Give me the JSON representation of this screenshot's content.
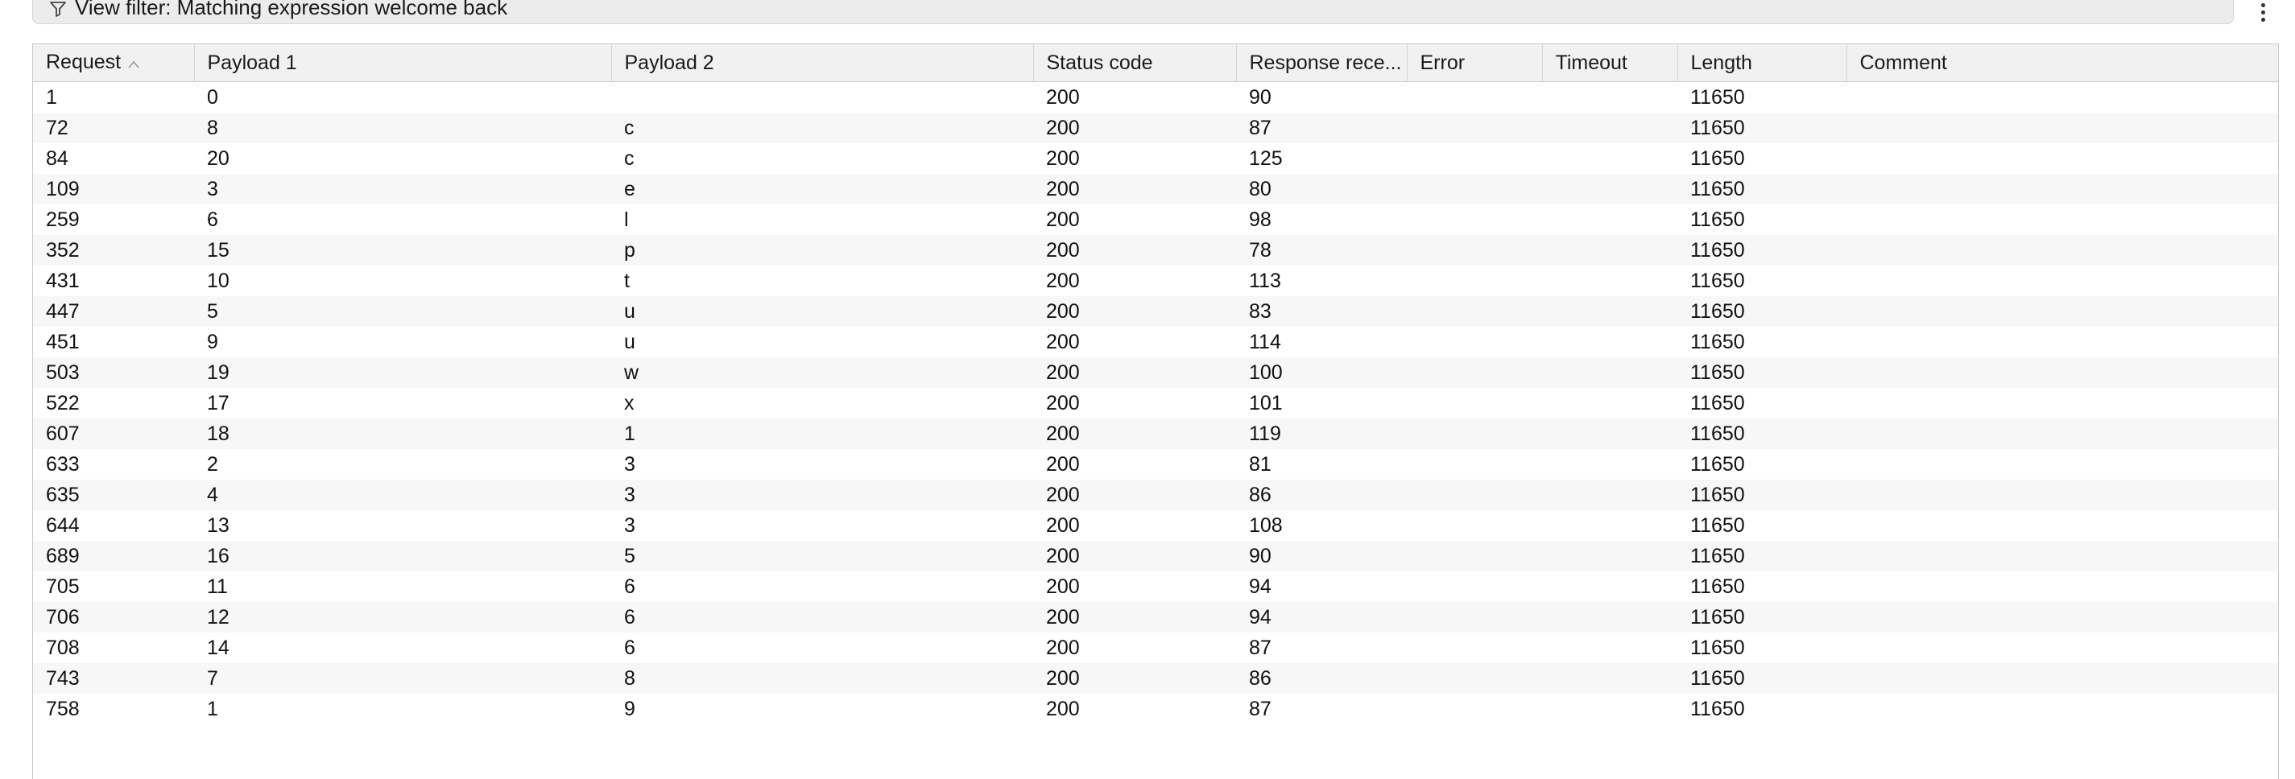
{
  "filter": {
    "label": "View filter: Matching expression welcome back",
    "icon": "filter-icon"
  },
  "table": {
    "columns": [
      {
        "key": "request",
        "label": "Request",
        "sorted": "asc"
      },
      {
        "key": "payload1",
        "label": "Payload 1"
      },
      {
        "key": "payload2",
        "label": "Payload 2"
      },
      {
        "key": "status",
        "label": "Status code"
      },
      {
        "key": "response",
        "label": "Response rece..."
      },
      {
        "key": "error",
        "label": "Error"
      },
      {
        "key": "timeout",
        "label": "Timeout"
      },
      {
        "key": "length",
        "label": "Length"
      },
      {
        "key": "comment",
        "label": "Comment"
      }
    ],
    "rows": [
      [
        "1",
        "0",
        "",
        "200",
        "90",
        "",
        "",
        "11650",
        ""
      ],
      [
        "72",
        "8",
        "c",
        "200",
        "87",
        "",
        "",
        "11650",
        ""
      ],
      [
        "84",
        "20",
        "c",
        "200",
        "125",
        "",
        "",
        "11650",
        ""
      ],
      [
        "109",
        "3",
        "e",
        "200",
        "80",
        "",
        "",
        "11650",
        ""
      ],
      [
        "259",
        "6",
        "l",
        "200",
        "98",
        "",
        "",
        "11650",
        ""
      ],
      [
        "352",
        "15",
        "p",
        "200",
        "78",
        "",
        "",
        "11650",
        ""
      ],
      [
        "431",
        "10",
        "t",
        "200",
        "113",
        "",
        "",
        "11650",
        ""
      ],
      [
        "447",
        "5",
        "u",
        "200",
        "83",
        "",
        "",
        "11650",
        ""
      ],
      [
        "451",
        "9",
        "u",
        "200",
        "114",
        "",
        "",
        "11650",
        ""
      ],
      [
        "503",
        "19",
        "w",
        "200",
        "100",
        "",
        "",
        "11650",
        ""
      ],
      [
        "522",
        "17",
        "x",
        "200",
        "101",
        "",
        "",
        "11650",
        ""
      ],
      [
        "607",
        "18",
        "1",
        "200",
        "119",
        "",
        "",
        "11650",
        ""
      ],
      [
        "633",
        "2",
        "3",
        "200",
        "81",
        "",
        "",
        "11650",
        ""
      ],
      [
        "635",
        "4",
        "3",
        "200",
        "86",
        "",
        "",
        "11650",
        ""
      ],
      [
        "644",
        "13",
        "3",
        "200",
        "108",
        "",
        "",
        "11650",
        ""
      ],
      [
        "689",
        "16",
        "5",
        "200",
        "90",
        "",
        "",
        "11650",
        ""
      ],
      [
        "705",
        "11",
        "6",
        "200",
        "94",
        "",
        "",
        "11650",
        ""
      ],
      [
        "706",
        "12",
        "6",
        "200",
        "94",
        "",
        "",
        "11650",
        ""
      ],
      [
        "708",
        "14",
        "6",
        "200",
        "87",
        "",
        "",
        "11650",
        ""
      ],
      [
        "743",
        "7",
        "8",
        "200",
        "86",
        "",
        "",
        "11650",
        ""
      ],
      [
        "758",
        "1",
        "9",
        "200",
        "87",
        "",
        "",
        "11650",
        ""
      ]
    ]
  },
  "icons": {
    "sort": "chevron-up-icon",
    "menu": "kebab-menu-icon"
  }
}
